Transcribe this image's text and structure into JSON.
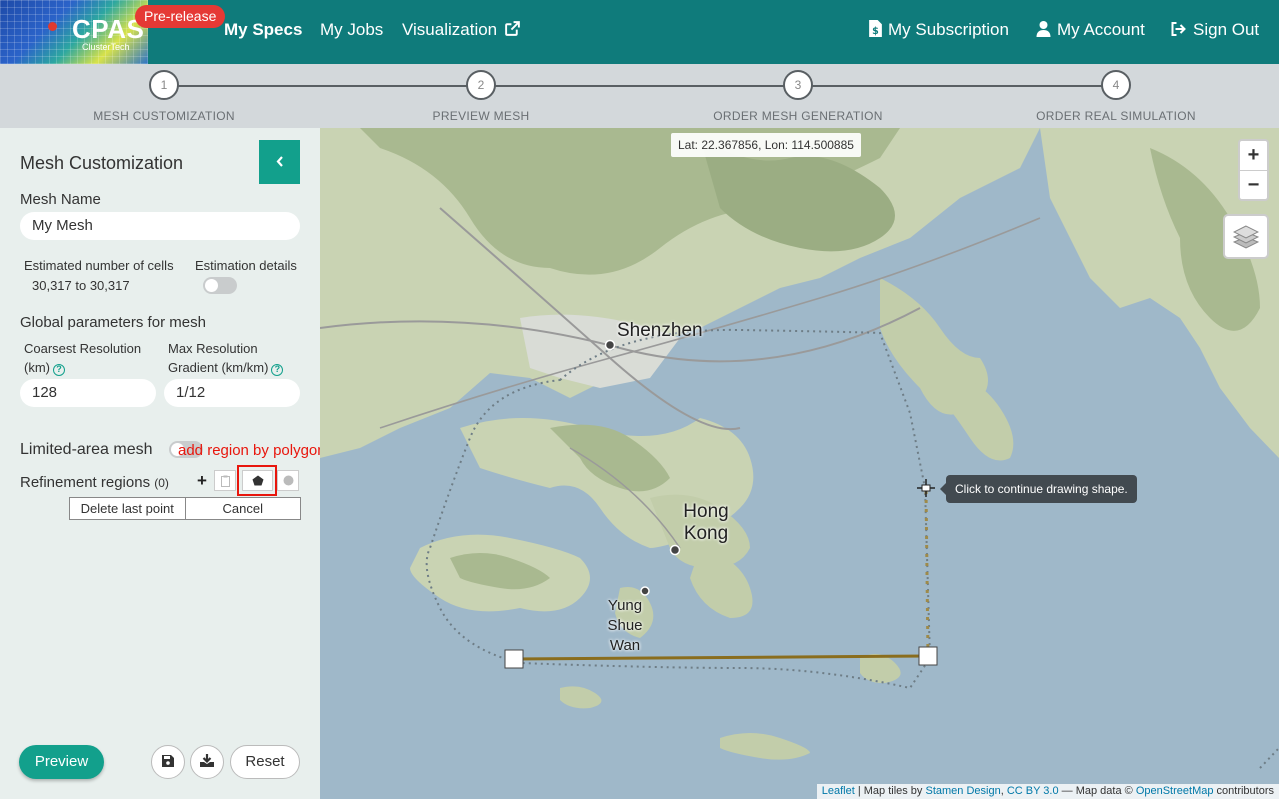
{
  "navbar": {
    "brand": "CPAS",
    "brand_sub": "ClusterTech",
    "badge": "Pre-release",
    "links": [
      "My Specs",
      "My Jobs",
      "Visualization"
    ],
    "right_links": [
      "My Subscription",
      "My Account",
      "Sign Out"
    ]
  },
  "stepper": {
    "steps": [
      {
        "num": "1",
        "label": "MESH CUSTOMIZATION"
      },
      {
        "num": "2",
        "label": "PREVIEW MESH"
      },
      {
        "num": "3",
        "label": "ORDER MESH GENERATION"
      },
      {
        "num": "4",
        "label": "ORDER REAL SIMULATION"
      }
    ]
  },
  "sidebar": {
    "title": "Mesh Customization",
    "mesh_name_label": "Mesh Name",
    "mesh_name_value": "My Mesh",
    "est_cells_label": "Estimated number of cells",
    "est_cells_value": "30,317 to 30,317",
    "est_details_label": "Estimation details",
    "global_params_label": "Global parameters for mesh",
    "coarsest_label_1": "Coarsest Resolution",
    "coarsest_label_2": "(km)",
    "coarsest_value": "128",
    "max_grad_label_1": "Max Resolution",
    "max_grad_label_2": "Gradient (km/km)",
    "max_grad_value": "1/12",
    "limited_area_label": "Limited-area mesh",
    "annotation": "add region by polygon",
    "refinement_label": "Refinement regions",
    "refinement_count": "(0)",
    "delete_last_point": "Delete last point",
    "cancel": "Cancel",
    "preview": "Preview",
    "reset": "Reset"
  },
  "map": {
    "coords": "Lat: 22.367856, Lon: 114.500885",
    "tooltip": "Click to continue drawing shape.",
    "cities": [
      "Shenzhen",
      "Hong Kong",
      "Yung Shue Wan"
    ],
    "attribution": {
      "leaflet": "Leaflet",
      "sep1": " | Map tiles by ",
      "stamen": "Stamen Design",
      "sep2": ", ",
      "license": "CC BY 3.0",
      "sep3": " — Map data © ",
      "osm": "OpenStreetMap",
      "sep4": " contributors"
    }
  },
  "colors": {
    "nav": "#0f7b7b",
    "accent": "#12a08c",
    "annotation": "#e8160d",
    "water": "#9fb8c9",
    "draw_line": "#8a6d1d"
  }
}
